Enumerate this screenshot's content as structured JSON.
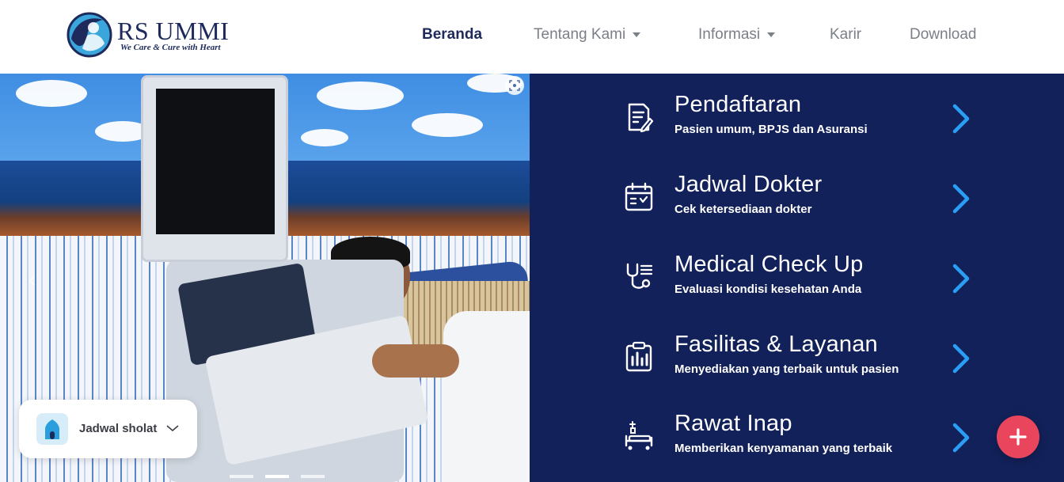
{
  "brand": {
    "name": "RS UMMI",
    "tagline": "We Care & Cure with Heart"
  },
  "nav": [
    {
      "label": "Beranda",
      "active": true,
      "dropdown": false
    },
    {
      "label": "Tentang Kami",
      "active": false,
      "dropdown": true
    },
    {
      "label": "Informasi",
      "active": false,
      "dropdown": true
    },
    {
      "label": "Karir",
      "active": false,
      "dropdown": false
    },
    {
      "label": "Download",
      "active": false,
      "dropdown": false
    }
  ],
  "sholat": {
    "label": "Jadwal sholat",
    "icon": "mosque-icon"
  },
  "services": [
    {
      "title": "Pendaftaran",
      "subtitle": "Pasien umum, BPJS dan Asuransi",
      "icon": "registration-form-icon"
    },
    {
      "title": "Jadwal Dokter",
      "subtitle": "Cek ketersediaan dokter",
      "icon": "calendar-icon"
    },
    {
      "title": "Medical Check Up",
      "subtitle": "Evaluasi kondisi kesehatan Anda",
      "icon": "stethoscope-icon"
    },
    {
      "title": "Fasilitas & Layanan",
      "subtitle": "Menyediakan yang terbaik untuk pasien",
      "icon": "clipboard-chart-icon"
    },
    {
      "title": "Rawat Inap",
      "subtitle": "Memberikan kenyamanan yang terbaik",
      "icon": "hospital-bed-icon"
    }
  ],
  "colors": {
    "brand_navy": "#1d2a5b",
    "panel_bg": "#13215a",
    "arrow_blue": "#2a9df4",
    "fab_red": "#e9465d",
    "nav_gray": "#7b7f87"
  }
}
